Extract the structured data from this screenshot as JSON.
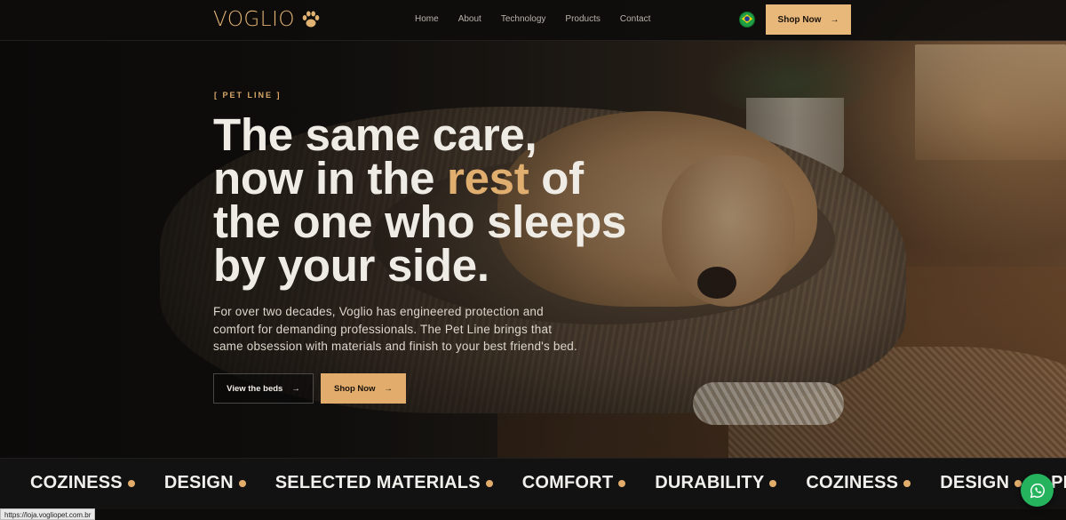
{
  "nav": {
    "logo": "VOGLIO",
    "items": [
      "Home",
      "About",
      "Technology",
      "Products",
      "Contact"
    ],
    "shop_label": "Shop Now",
    "arrow": "→"
  },
  "hero": {
    "eyebrow": "[ PET LINE ]",
    "headline": {
      "line1": "The same care,",
      "line2_pre": "now in the ",
      "line2_accent": "rest",
      "line2_post": " of",
      "line3": "the one who sleeps",
      "line4": "by your side."
    },
    "lead": "For over two decades, Voglio has engineered protection and comfort for demanding professionals. The Pet Line brings that same obsession with materials and finish to your best friend's bed.",
    "buttons": {
      "view_beds": "View the beds",
      "shop_now": "Shop Now",
      "arrow": "→"
    }
  },
  "marquee": {
    "items": [
      "COZINESS",
      "DESIGN",
      "SELECTED MATERIALS",
      "COMFORT",
      "DURABILITY",
      "COZINESS",
      "DESIGN",
      "PLE"
    ]
  },
  "status_url": "https://loja.vogliopet.com.br",
  "colors": {
    "accent": "#e2ad6c",
    "whatsapp": "#25b45d",
    "brazil_flag": "#1f9e45"
  },
  "icons": {
    "logo_mark": "paw-icon",
    "language": "brazil-flag-icon",
    "floating": "whatsapp-icon"
  }
}
